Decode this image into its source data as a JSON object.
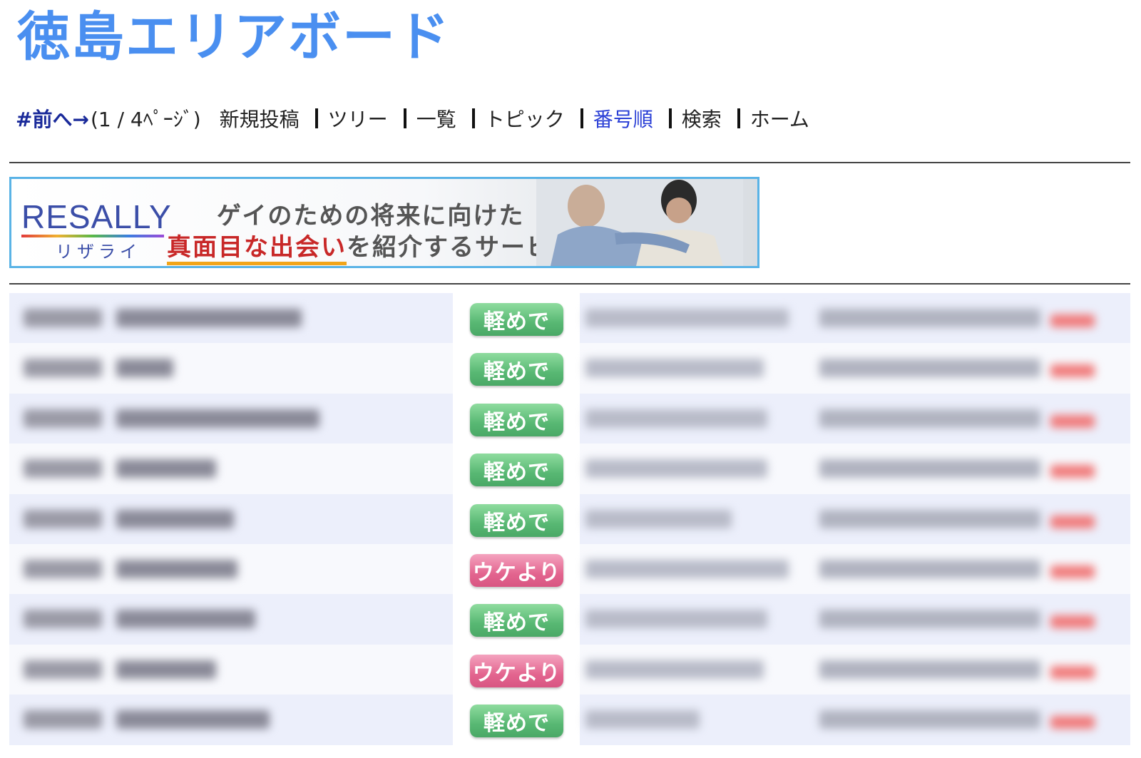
{
  "header": {
    "title": "徳島エリアボード"
  },
  "nav": {
    "prev_label": "#前へ→",
    "page_info": "(1 / 4ﾍﾟｰｼﾞ)",
    "items": [
      "新規投稿",
      "ツリー",
      "一覧",
      "トピック",
      "番号順",
      "検索",
      "ホーム"
    ],
    "active_item": "番号順"
  },
  "banner": {
    "logo": "RESALLY",
    "logo_sub": "リザライ",
    "line1": "ゲイのための将来に向けた",
    "line2_highlight": "真面目な出会い",
    "line2_rest": "を紹介するサービス"
  },
  "posts": [
    {
      "badge": "軽めで",
      "badge_type": "green"
    },
    {
      "badge": "軽めで",
      "badge_type": "green"
    },
    {
      "badge": "軽めで",
      "badge_type": "green"
    },
    {
      "badge": "軽めで",
      "badge_type": "green"
    },
    {
      "badge": "軽めで",
      "badge_type": "green"
    },
    {
      "badge": "ウケより",
      "badge_type": "pink"
    },
    {
      "badge": "軽めで",
      "badge_type": "green"
    },
    {
      "badge": "ウケより",
      "badge_type": "pink"
    },
    {
      "badge": "軽めで",
      "badge_type": "green"
    }
  ],
  "colors": {
    "title": "#4a8ff0",
    "nav_active": "#2a3fd6",
    "badge_green": "#58b873",
    "badge_pink": "#e3658f",
    "banner_border": "#5ab3e6"
  }
}
